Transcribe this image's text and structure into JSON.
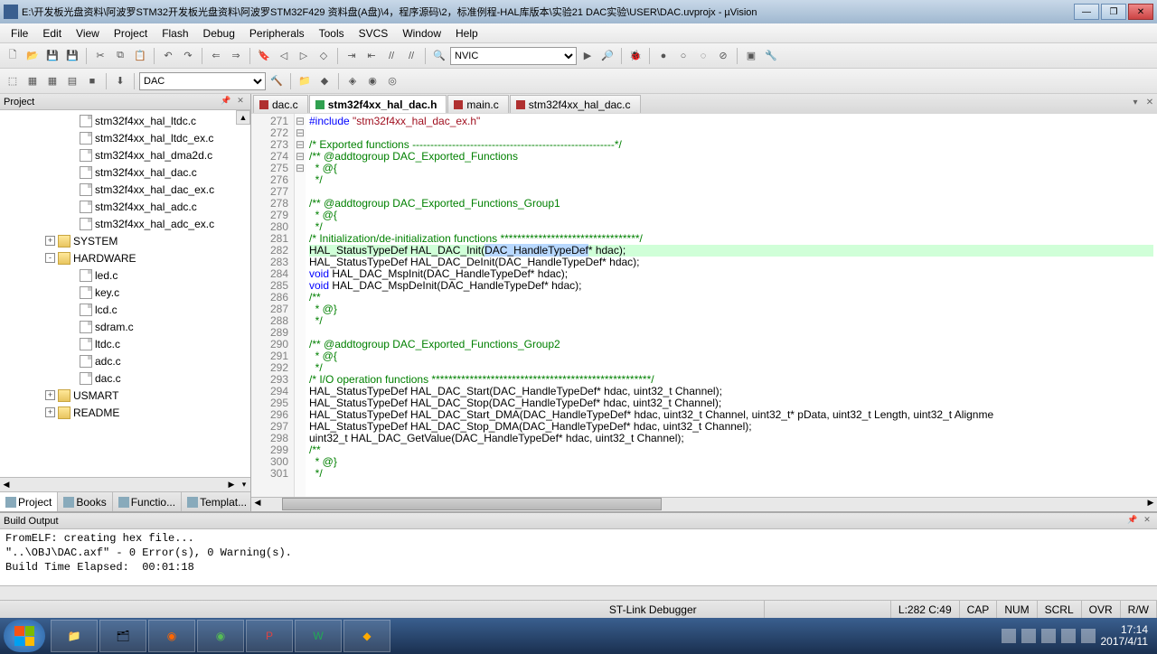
{
  "window": {
    "title": "E:\\开发板光盘资料\\阿波罗STM32开发板光盘资料\\阿波罗STM32F429 资料盘(A盘)\\4，程序源码\\2，标准例程-HAL库版本\\实验21 DAC实验\\USER\\DAC.uvprojx - µVision",
    "minimize": "—",
    "restore": "❐",
    "close": "✕"
  },
  "menu": [
    "File",
    "Edit",
    "View",
    "Project",
    "Flash",
    "Debug",
    "Peripherals",
    "Tools",
    "SVCS",
    "Window",
    "Help"
  ],
  "toolbar1_combo": "NVIC",
  "toolbar2_combo": "DAC",
  "project": {
    "title": "Project",
    "files": [
      "stm32f4xx_hal_ltdc.c",
      "stm32f4xx_hal_ltdc_ex.c",
      "stm32f4xx_hal_dma2d.c",
      "stm32f4xx_hal_dac.c",
      "stm32f4xx_hal_dac_ex.c",
      "stm32f4xx_hal_adc.c",
      "stm32f4xx_hal_adc_ex.c"
    ],
    "folders": [
      {
        "name": "SYSTEM",
        "exp": "+"
      },
      {
        "name": "HARDWARE",
        "exp": "-",
        "children": [
          "led.c",
          "key.c",
          "lcd.c",
          "sdram.c",
          "ltdc.c",
          "adc.c",
          "dac.c"
        ]
      },
      {
        "name": "USMART",
        "exp": "+"
      },
      {
        "name": "README",
        "exp": "+"
      }
    ],
    "tabs": [
      "Project",
      "Books",
      "Functio...",
      "Templat..."
    ]
  },
  "editor": {
    "tabs": [
      {
        "name": "dac.c",
        "type": "c"
      },
      {
        "name": "stm32f4xx_hal_dac.h",
        "type": "h",
        "active": true
      },
      {
        "name": "main.c",
        "type": "c"
      },
      {
        "name": "stm32f4xx_hal_dac.c",
        "type": "c"
      }
    ],
    "first_line": 271,
    "lines": [
      {
        "t": "#include \"stm32f4xx_hal_dac_ex.h\"",
        "k": "inc"
      },
      {
        "t": ""
      },
      {
        "t": "/* Exported functions --------------------------------------------------------*/",
        "k": "cm"
      },
      {
        "t": "/** @addtogroup DAC_Exported_Functions",
        "k": "cm",
        "fold": "-"
      },
      {
        "t": "  * @{",
        "k": "cm"
      },
      {
        "t": "  */",
        "k": "cm"
      },
      {
        "t": ""
      },
      {
        "t": "/** @addtogroup DAC_Exported_Functions_Group1",
        "k": "cm",
        "fold": "-"
      },
      {
        "t": "  * @{",
        "k": "cm"
      },
      {
        "t": "  */",
        "k": "cm"
      },
      {
        "t": "/* Initialization/de-initialization functions *********************************/",
        "k": "cm"
      },
      {
        "t": "HAL_StatusTypeDef HAL_DAC_Init(DAC_HandleTypeDef* hdac);",
        "hl": true,
        "sel": "DAC_HandleTypeDef"
      },
      {
        "t": "HAL_StatusTypeDef HAL_DAC_DeInit(DAC_HandleTypeDef* hdac);"
      },
      {
        "t": "void HAL_DAC_MspInit(DAC_HandleTypeDef* hdac);",
        "kw": "void"
      },
      {
        "t": "void HAL_DAC_MspDeInit(DAC_HandleTypeDef* hdac);",
        "kw": "void"
      },
      {
        "t": "/**",
        "k": "cm",
        "fold": "-"
      },
      {
        "t": "  * @}",
        "k": "cm"
      },
      {
        "t": "  */",
        "k": "cm"
      },
      {
        "t": ""
      },
      {
        "t": "/** @addtogroup DAC_Exported_Functions_Group2",
        "k": "cm",
        "fold": "-"
      },
      {
        "t": "  * @{",
        "k": "cm"
      },
      {
        "t": "  */",
        "k": "cm"
      },
      {
        "t": "/* I/O operation functions ****************************************************/",
        "k": "cm"
      },
      {
        "t": "HAL_StatusTypeDef HAL_DAC_Start(DAC_HandleTypeDef* hdac, uint32_t Channel);"
      },
      {
        "t": "HAL_StatusTypeDef HAL_DAC_Stop(DAC_HandleTypeDef* hdac, uint32_t Channel);"
      },
      {
        "t": "HAL_StatusTypeDef HAL_DAC_Start_DMA(DAC_HandleTypeDef* hdac, uint32_t Channel, uint32_t* pData, uint32_t Length, uint32_t Alignme"
      },
      {
        "t": "HAL_StatusTypeDef HAL_DAC_Stop_DMA(DAC_HandleTypeDef* hdac, uint32_t Channel);"
      },
      {
        "t": "uint32_t HAL_DAC_GetValue(DAC_HandleTypeDef* hdac, uint32_t Channel);"
      },
      {
        "t": "/**",
        "k": "cm",
        "fold": "-"
      },
      {
        "t": "  * @}",
        "k": "cm"
      },
      {
        "t": "  */",
        "k": "cm"
      }
    ]
  },
  "build": {
    "title": "Build Output",
    "text": "FromELF: creating hex file...\n\"..\\OBJ\\DAC.axf\" - 0 Error(s), 0 Warning(s).\nBuild Time Elapsed:  00:01:18"
  },
  "status": {
    "debugger": "ST-Link Debugger",
    "pos": "L:282 C:49",
    "caps": "CAP",
    "num": "NUM",
    "scrl": "SCRL",
    "ovr": "OVR",
    "rw": "R/W"
  },
  "tray": {
    "time": "17:14",
    "date": "2017/4/11"
  }
}
